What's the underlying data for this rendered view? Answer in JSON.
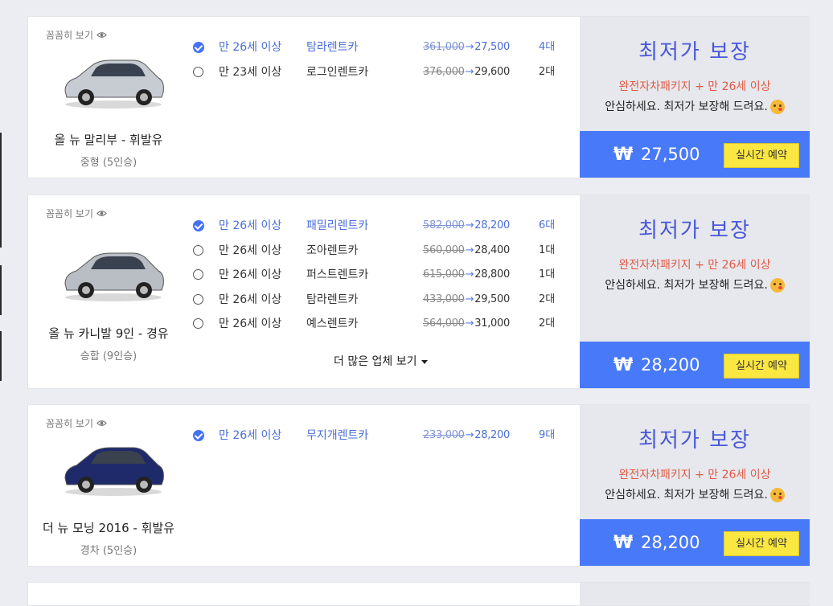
{
  "listings": [
    {
      "peek_label": "꼼꼼히 보기",
      "car_name": "올 뉴 말리부 - 휘발유",
      "car_sub": "중형 (5인승)",
      "car_color": "#c7ccd3",
      "offers": [
        {
          "selected": true,
          "age": "만 26세 이상",
          "company": "탐라렌트카",
          "orig": "361,000",
          "price": "27,500",
          "count": "4대"
        },
        {
          "selected": false,
          "age": "만 23세 이상",
          "company": "로그인렌트카",
          "orig": "376,000",
          "price": "29,600",
          "count": "2대"
        }
      ],
      "guarantee": "최저가 보장",
      "package": "완전자차패키지 + 만 26세 이상",
      "assure": "안심하세요. 최저가 보장해 드려요.",
      "won": "₩",
      "total": "27,500",
      "reserve": "실시간 예약"
    },
    {
      "peek_label": "꼼꼼히 보기",
      "car_name": "올 뉴 카니발 9인 - 경유",
      "car_sub": "승합 (9인승)",
      "car_color": "#b9bdc4",
      "offers": [
        {
          "selected": true,
          "age": "만 26세 이상",
          "company": "패밀리렌트카",
          "orig": "582,000",
          "price": "28,200",
          "count": "6대"
        },
        {
          "selected": false,
          "age": "만 26세 이상",
          "company": "조아렌트카",
          "orig": "560,000",
          "price": "28,400",
          "count": "1대"
        },
        {
          "selected": false,
          "age": "만 26세 이상",
          "company": "퍼스트렌트카",
          "orig": "615,000",
          "price": "28,800",
          "count": "1대"
        },
        {
          "selected": false,
          "age": "만 26세 이상",
          "company": "탐라렌트카",
          "orig": "433,000",
          "price": "29,500",
          "count": "2대"
        },
        {
          "selected": false,
          "age": "만 26세 이상",
          "company": "예스렌트카",
          "orig": "564,000",
          "price": "31,000",
          "count": "2대"
        }
      ],
      "more": "더 많은 업체 보기",
      "guarantee": "최저가 보장",
      "package": "완전자차패키지 + 만 26세 이상",
      "assure": "안심하세요. 최저가 보장해 드려요.",
      "won": "₩",
      "total": "28,200",
      "reserve": "실시간 예약"
    },
    {
      "peek_label": "꼼꼼히 보기",
      "car_name": "더 뉴 모닝 2016 - 휘발유",
      "car_sub": "경차 (5인승)",
      "car_color": "#1f2a6b",
      "offers": [
        {
          "selected": true,
          "age": "만 26세 이상",
          "company": "무지개렌트카",
          "orig": "233,000",
          "price": "28,200",
          "count": "9대"
        }
      ],
      "guarantee": "최저가 보장",
      "package": "완전자차패키지 + 만 26세 이상",
      "assure": "안심하세요. 최저가 보장해 드려요.",
      "won": "₩",
      "total": "28,200",
      "reserve": "실시간 예약"
    }
  ]
}
